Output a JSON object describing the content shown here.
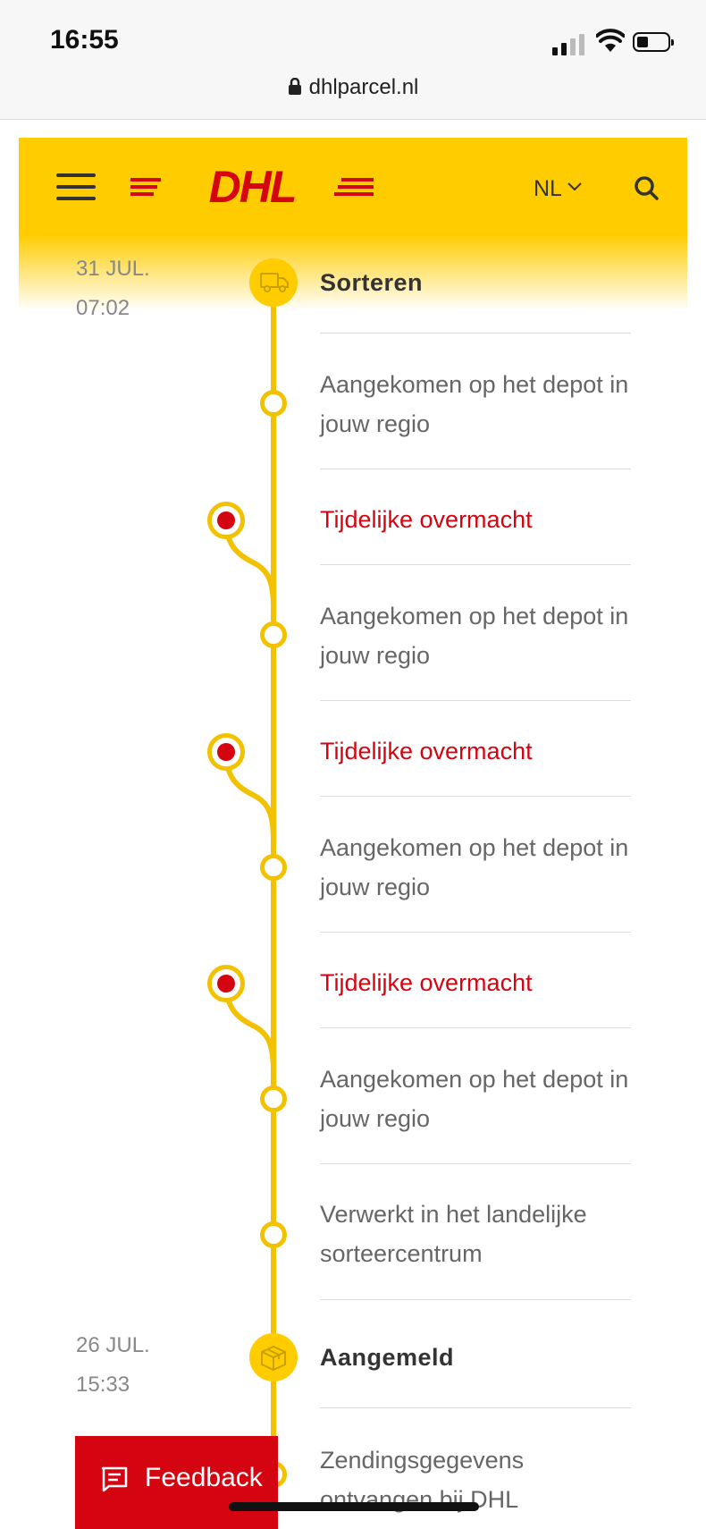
{
  "status_bar": {
    "time": "16:55"
  },
  "browser": {
    "url": "dhlparcel.nl"
  },
  "header": {
    "brand": "DHL",
    "language": "NL"
  },
  "timeline": {
    "dates": [
      {
        "date": "31 JUL.",
        "time": "07:02"
      },
      {
        "date": "26 JUL.",
        "time": "15:33"
      }
    ],
    "events": [
      {
        "text": "Sorteren",
        "style": "main-status",
        "icon": "truck-icon"
      },
      {
        "text": "Aangekomen op het depot in jouw regio",
        "style": "normal"
      },
      {
        "text": "Tijdelijke overmacht",
        "style": "warning"
      },
      {
        "text": "Aangekomen op het depot in jouw regio",
        "style": "normal"
      },
      {
        "text": "Tijdelijke overmacht",
        "style": "warning"
      },
      {
        "text": "Aangekomen op het depot in jouw regio",
        "style": "normal"
      },
      {
        "text": "Tijdelijke overmacht",
        "style": "warning"
      },
      {
        "text": "Aangekomen op het depot in jouw regio",
        "style": "normal"
      },
      {
        "text": "Verwerkt in het landelijke sorteercentrum",
        "style": "normal"
      },
      {
        "text": "Aangemeld",
        "style": "main-status",
        "icon": "package-icon"
      },
      {
        "text": "Zendingsgegevens ontvangen bij DHL",
        "style": "normal"
      }
    ]
  },
  "feedback": {
    "label": "Feedback"
  },
  "colors": {
    "brand_yellow": "#ffcc00",
    "brand_red": "#d40511",
    "timeline_yellow": "#f2c200"
  }
}
